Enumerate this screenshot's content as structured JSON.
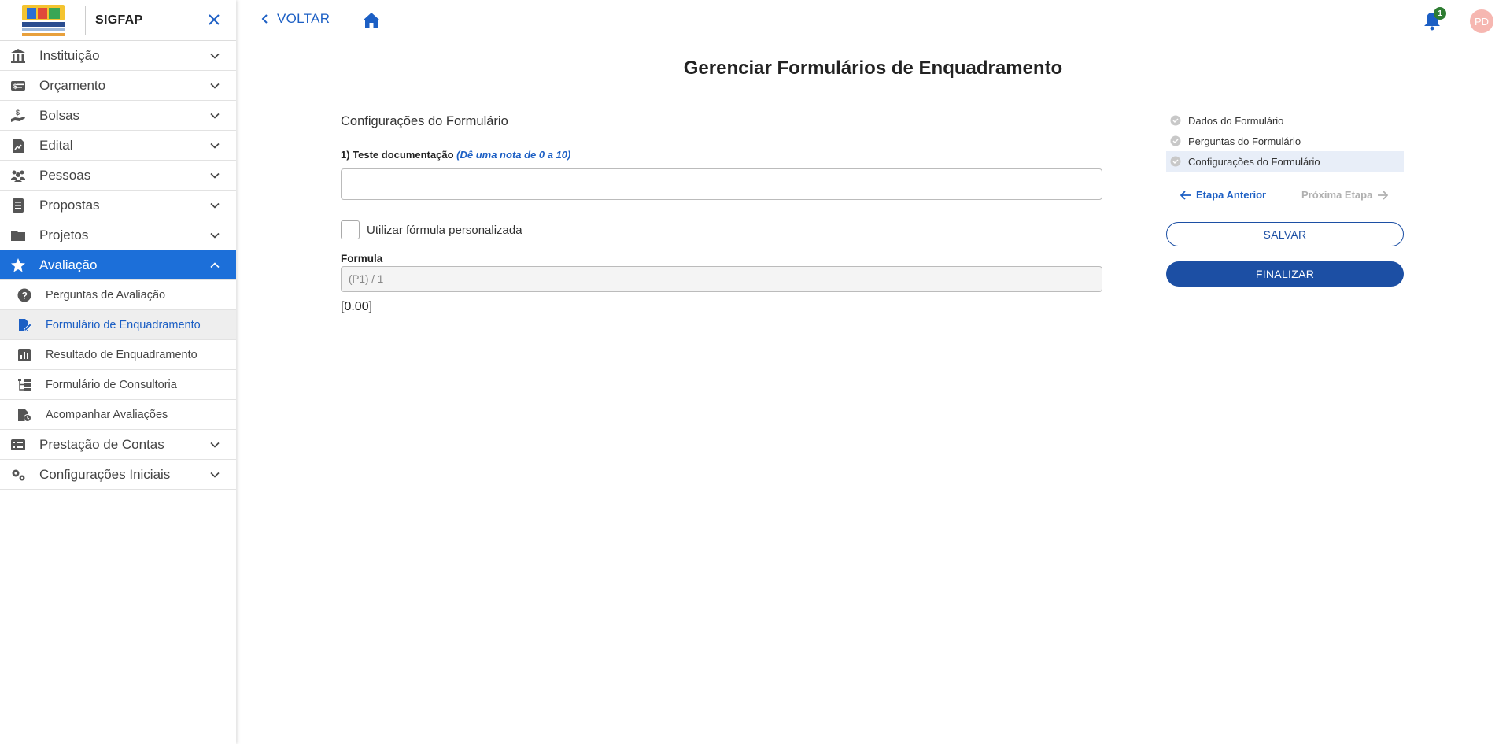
{
  "app": {
    "title": "SIGFAP"
  },
  "sidebar": {
    "items": [
      {
        "label": "Instituição",
        "icon": "bank-icon"
      },
      {
        "label": "Orçamento",
        "icon": "money-card-icon"
      },
      {
        "label": "Bolsas",
        "icon": "hand-money-icon"
      },
      {
        "label": "Edital",
        "icon": "document-chart-icon"
      },
      {
        "label": "Pessoas",
        "icon": "people-icon"
      },
      {
        "label": "Propostas",
        "icon": "document-list-icon"
      },
      {
        "label": "Projetos",
        "icon": "folder-icon"
      },
      {
        "label": "Avaliação",
        "icon": "star-icon",
        "active": true
      },
      {
        "label": "Prestação de Contas",
        "icon": "list-icon"
      },
      {
        "label": "Configurações Iniciais",
        "icon": "gears-icon"
      }
    ],
    "subitems": [
      {
        "label": "Perguntas de Avaliação",
        "icon": "question-circle-icon"
      },
      {
        "label": "Formulário de Enquadramento",
        "icon": "file-edit-icon",
        "selected": true
      },
      {
        "label": "Resultado de Enquadramento",
        "icon": "bar-chart-icon"
      },
      {
        "label": "Formulário de Consultoria",
        "icon": "tree-structure-icon"
      },
      {
        "label": "Acompanhar Avaliações",
        "icon": "file-clock-icon"
      }
    ]
  },
  "topbar": {
    "back_label": "VOLTAR",
    "notification_count": "1",
    "avatar_initials": "PD"
  },
  "page": {
    "title": "Gerenciar Formulários de Enquadramento",
    "section_title": "Configurações do Formulário",
    "question_label": "1) Teste documentação",
    "question_hint": "(Dê uma nota de 0 a 10)",
    "answer_value": "",
    "custom_formula_label": "Utilizar fórmula personalizada",
    "formula_label": "Formula",
    "formula_value": "(P1) / 1",
    "result": "[0.00]"
  },
  "steps": {
    "items": [
      {
        "label": "Dados do Formulário"
      },
      {
        "label": "Perguntas do Formulário"
      },
      {
        "label": "Configurações do Formulário",
        "current": true
      }
    ],
    "prev_label": "Etapa Anterior",
    "next_label": "Próxima Etapa",
    "save_label": "SALVAR",
    "finish_label": "FINALIZAR"
  },
  "colors": {
    "primary": "#1c6fd9",
    "primary_dark": "#1c4fa4",
    "badge": "#2e7d32",
    "avatar": "#f6b7b1"
  }
}
